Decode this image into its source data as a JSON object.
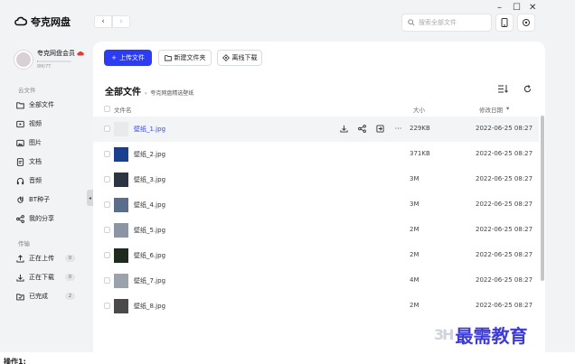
{
  "app": {
    "name": "夸克网盘"
  },
  "window": {
    "minimize": "–",
    "maximize": "☐",
    "close": "✕"
  },
  "search": {
    "placeholder": "搜索全部文件"
  },
  "user": {
    "name": "夸克网盘会员",
    "quota": "8M/7T",
    "quota_fraction": 0.02
  },
  "sidebar": {
    "section_cloud": "云文件",
    "items": [
      {
        "label": "全部文件",
        "icon": "folder-icon"
      },
      {
        "label": "视频",
        "icon": "video-icon"
      },
      {
        "label": "图片",
        "icon": "image-icon"
      },
      {
        "label": "文档",
        "icon": "document-icon"
      },
      {
        "label": "音频",
        "icon": "headphones-icon"
      },
      {
        "label": "BT种子",
        "icon": "magnet-icon"
      },
      {
        "label": "我的分享",
        "icon": "share-icon"
      }
    ],
    "section_transfer": "传输",
    "transfers": [
      {
        "label": "正在上传",
        "count": "0",
        "icon": "upload-icon"
      },
      {
        "label": "正在下载",
        "count": "0",
        "icon": "download-icon"
      },
      {
        "label": "已完成",
        "count": "2",
        "icon": "completed-icon"
      }
    ]
  },
  "toolbar": {
    "upload": "上传文件",
    "new_folder": "新建文件夹",
    "offline_download": "离线下载"
  },
  "breadcrumb": {
    "root": "全部文件",
    "sub": "夸克网盘精选壁纸"
  },
  "table": {
    "headers": {
      "name": "文件名",
      "size": "大小",
      "date": "修改日期"
    },
    "rows": [
      {
        "name": "壁纸_1.jpg",
        "size": "229KB",
        "date": "2022-06-25 08:27",
        "thumb": "#e8eaec"
      },
      {
        "name": "壁纸_2.jpg",
        "size": "371KB",
        "date": "2022-06-25 08:27",
        "thumb": "#1a3f8f"
      },
      {
        "name": "壁纸_3.jpg",
        "size": "3M",
        "date": "2022-06-25 08:27",
        "thumb": "#2d3444"
      },
      {
        "name": "壁纸_4.jpg",
        "size": "3M",
        "date": "2022-06-25 08:27",
        "thumb": "#5a6d8a"
      },
      {
        "name": "壁纸_5.jpg",
        "size": "2M",
        "date": "2022-06-25 08:27",
        "thumb": "#8c95a6"
      },
      {
        "name": "壁纸_6.jpg",
        "size": "2M",
        "date": "2022-06-25 08:27",
        "thumb": "#1e2a1e"
      },
      {
        "name": "壁纸_7.jpg",
        "size": "4M",
        "date": "2022-06-25 08:27",
        "thumb": "#9aa3ac"
      },
      {
        "name": "壁纸_8.jpg",
        "size": "2M",
        "date": "2022-06-25 08:27",
        "thumb": "#4a4a4a"
      }
    ]
  },
  "watermark": {
    "logo": "3H",
    "text": "最需教育"
  },
  "caption": "操作1:"
}
